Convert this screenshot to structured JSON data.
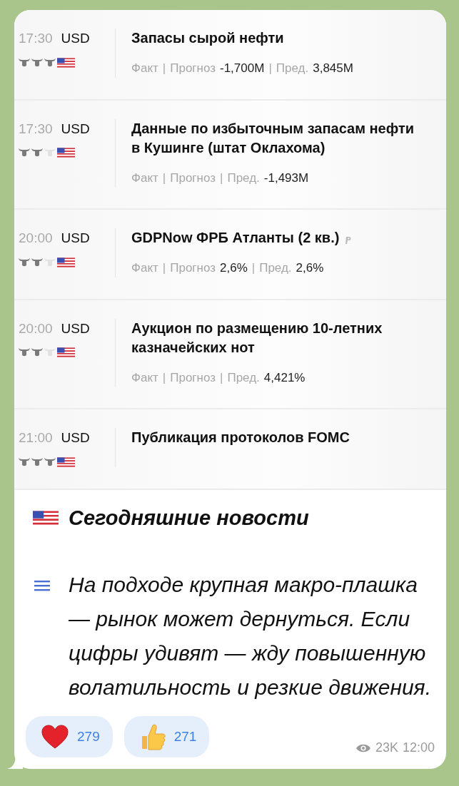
{
  "calendar": {
    "events": [
      {
        "time": "17:30",
        "currency": "USD",
        "stars": 3,
        "title": "Запасы сырой нефти",
        "preliminary": false,
        "stats": [
          {
            "label": "Факт"
          },
          {
            "separator": "|",
            "label": "Прогноз",
            "value": "-1,700M"
          },
          {
            "separator": "|",
            "label": "Пред.",
            "value": "3,845M"
          }
        ]
      },
      {
        "time": "17:30",
        "currency": "USD",
        "stars": 2,
        "title": "Данные по избыточным запасам нефти в Кушинге (штат Оклахома)",
        "preliminary": false,
        "stats": [
          {
            "label": "Факт"
          },
          {
            "separator": "|",
            "label": "Прогноз"
          },
          {
            "separator": "|",
            "label": "Пред.",
            "value": "-1,493M"
          }
        ]
      },
      {
        "time": "20:00",
        "currency": "USD",
        "stars": 2,
        "title": "GDPNow ФРБ Атланты (2 кв.)",
        "preliminary": true,
        "stats": [
          {
            "label": "Факт"
          },
          {
            "separator": "|",
            "label": "Прогноз",
            "value": "2,6%"
          },
          {
            "separator": "|",
            "label": "Пред.",
            "value": "2,6%"
          }
        ]
      },
      {
        "time": "20:00",
        "currency": "USD",
        "stars": 2,
        "title": "Аукцион по размещению 10-летних казначейских нот",
        "preliminary": false,
        "stats": [
          {
            "label": "Факт"
          },
          {
            "separator": "|",
            "label": "Прогноз"
          },
          {
            "separator": "|",
            "label": "Пред.",
            "value": "4,421%"
          }
        ]
      },
      {
        "time": "21:00",
        "currency": "USD",
        "stars": 3,
        "title": "Публикация протоколов FOMC",
        "preliminary": false
      }
    ]
  },
  "message": {
    "heading": "Сегодняшние новости",
    "body": "На подходе крупная макро-плашка — рынок может дернуться. Если цифры удивят — жду повышенную волатильность и резкие движения."
  },
  "reactions": [
    {
      "kind": "heart",
      "count": "279"
    },
    {
      "kind": "thumbs-up",
      "count": "271"
    }
  ],
  "footer": {
    "views": "23K",
    "time": "12:00"
  }
}
